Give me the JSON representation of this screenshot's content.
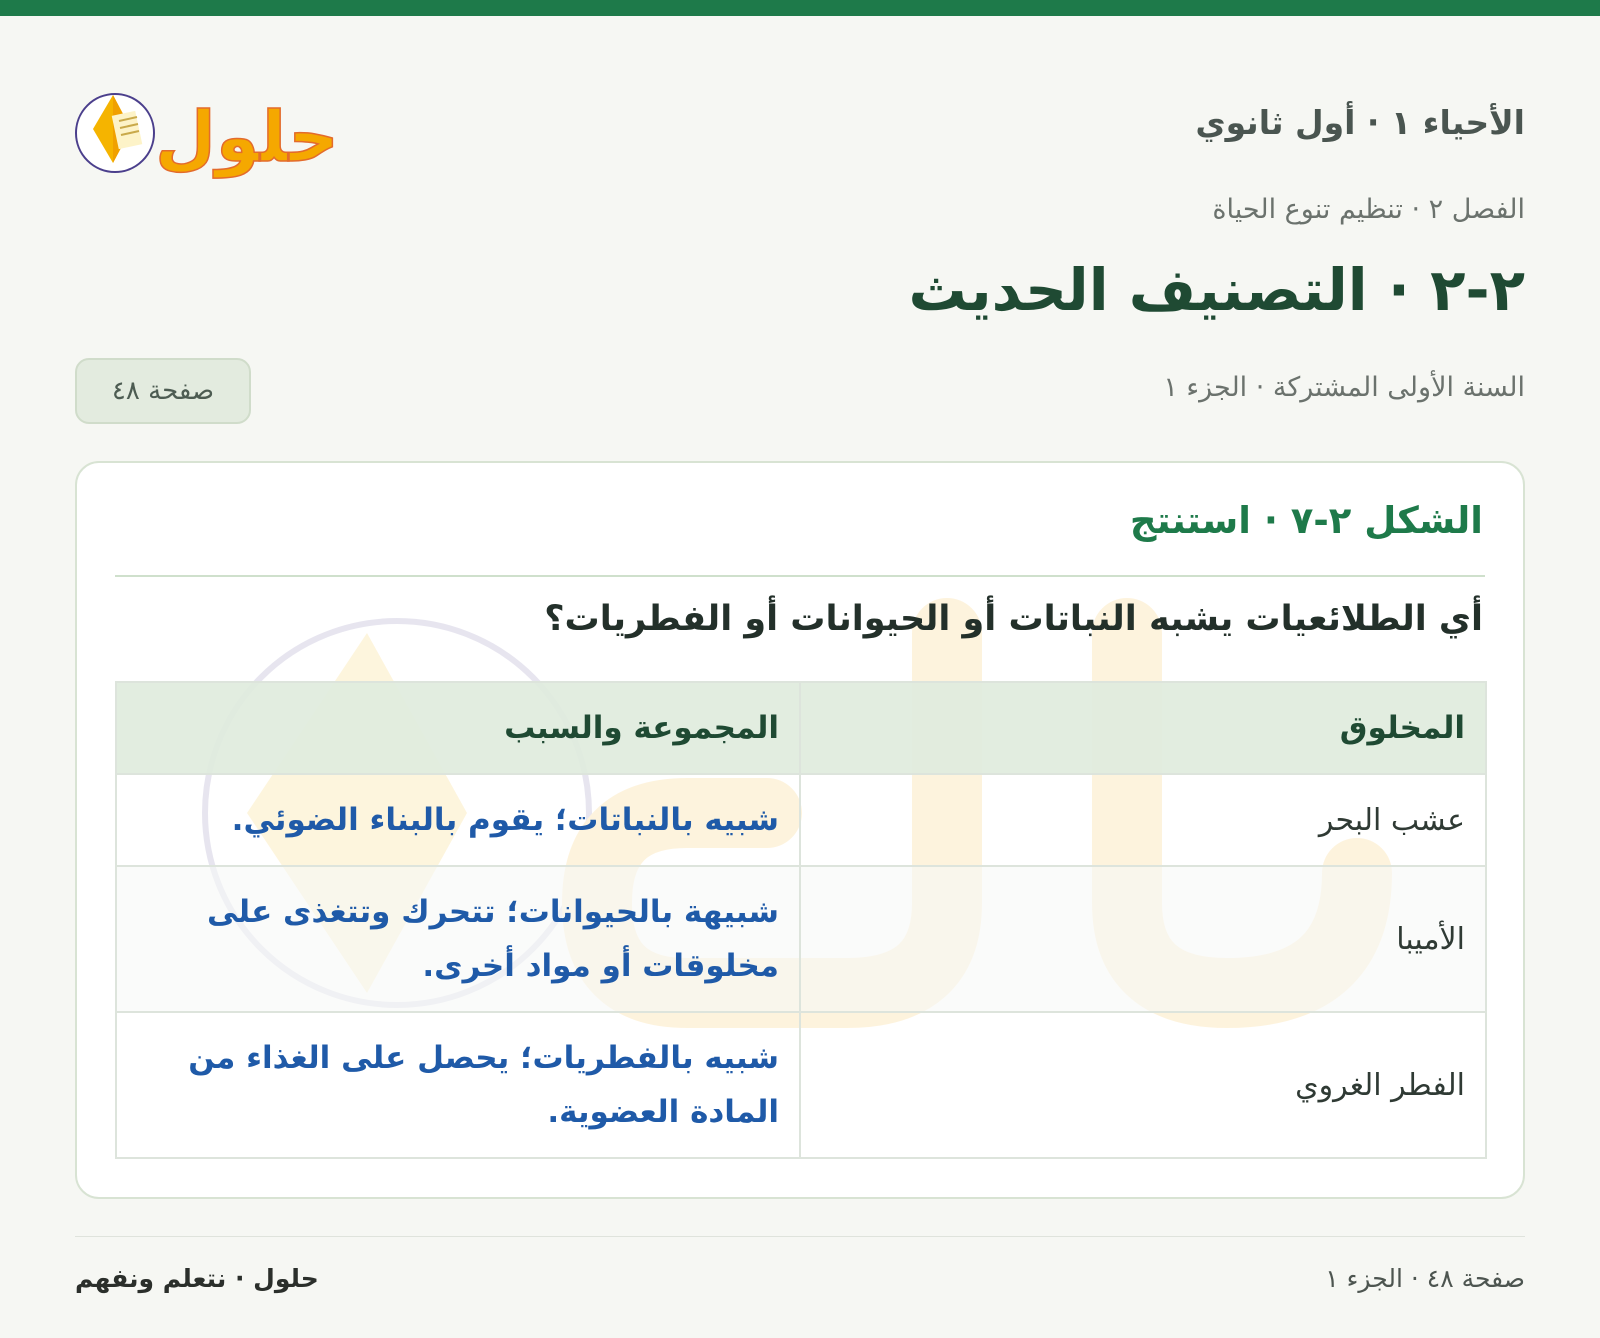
{
  "header": {
    "subject": "الأحياء ١ · أول ثانوي",
    "logo_text": "حلول"
  },
  "chapter": "الفصل ٢ · تنظيم تنوع الحياة",
  "lesson_title": "٢-٢ · التصنيف الحديث",
  "meta": {
    "course": "السنة الأولى المشتركة · الجزء ١",
    "page_pill": "صفحة ٤٨"
  },
  "figure": {
    "title": "الشكل ٢-٧ · استنتج",
    "question": "أي الطلائعيات يشبه النباتات أو الحيوانات أو الفطريات؟",
    "table": {
      "headers": {
        "organism": "المخلوق",
        "group": "المجموعة والسبب"
      },
      "rows": [
        {
          "organism": "عشب البحر",
          "answer": "شبيه بالنباتات؛ يقوم بالبناء الضوئي."
        },
        {
          "organism": "الأميبا",
          "answer": "شبيهة بالحيوانات؛ تتحرك وتتغذى على مخلوقات أو مواد أخرى."
        },
        {
          "organism": "الفطر الغروي",
          "answer": "شبيه بالفطريات؛ يحصل على الغذاء من المادة العضوية."
        }
      ]
    }
  },
  "footer": {
    "page": "صفحة ٤٨ · الجزء ١",
    "brand": "حلول · نتعلم ونفهم"
  },
  "colors": {
    "accent": "#1e7a4a",
    "answer": "#1f5aa8",
    "heading": "#1f4a33"
  }
}
